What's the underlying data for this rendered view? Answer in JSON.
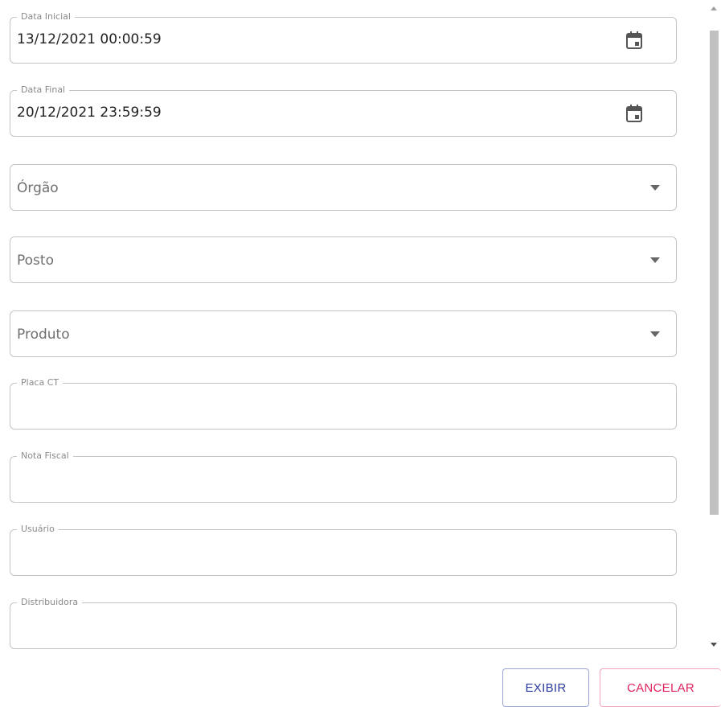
{
  "form": {
    "data_inicial": {
      "label": "Data Inicial",
      "value": "13/12/2021 00:00:59"
    },
    "data_final": {
      "label": "Data Final",
      "value": "20/12/2021 23:59:59"
    },
    "orgao": {
      "placeholder": "Órgão"
    },
    "posto": {
      "placeholder": "Posto"
    },
    "produto": {
      "placeholder": "Produto"
    },
    "placa_ct": {
      "label": "Placa CT",
      "value": ""
    },
    "nota_fiscal": {
      "label": "Nota Fiscal",
      "value": ""
    },
    "usuario": {
      "label": "Usuário",
      "value": ""
    },
    "distribuidora": {
      "label": "Distribuidora",
      "value": ""
    }
  },
  "actions": {
    "exibir_label": "EXIBIR",
    "cancelar_label": "CANCELAR"
  },
  "colors": {
    "exibir": "#2b3a9e",
    "cancelar": "#e0245e",
    "border": "#c4c4c4"
  },
  "icons": {
    "date": "calendar-icon",
    "dropdown": "chevron-down-icon"
  }
}
